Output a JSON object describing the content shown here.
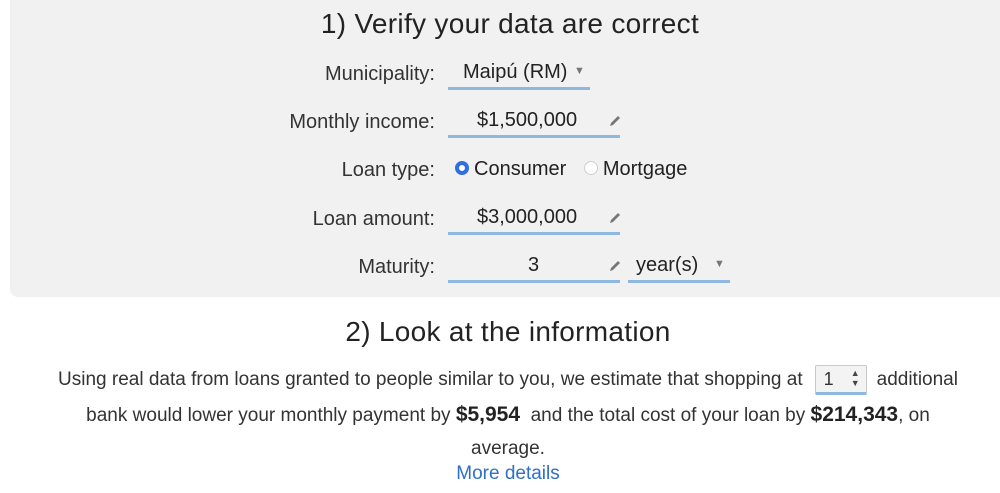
{
  "section1": {
    "title": "1) Verify your data are correct",
    "municipality_label": "Municipality:",
    "municipality_value": "Maipú (RM)",
    "income_label": "Monthly income:",
    "income_value": "$1,500,000",
    "loan_type_label": "Loan type:",
    "loan_type_options": [
      "Consumer",
      "Mortgage"
    ],
    "loan_type_selected": "Consumer",
    "amount_label": "Loan amount:",
    "amount_value": "$3,000,000",
    "maturity_label": "Maturity:",
    "maturity_value": "3",
    "maturity_unit": "year(s)"
  },
  "section2": {
    "title": "2) Look at the information",
    "text_before": "Using real data from loans granted to people similar to you, we estimate that shopping at",
    "banks_value": "1",
    "text_after_banks": "additional",
    "text_line2": "bank would lower your monthly payment by",
    "monthly_saving": "$5,954",
    "text_mid": "and the total cost of your loan by",
    "total_saving": "$214,343",
    "text_end": ", on",
    "text_line3": "average.",
    "more_link": "More details"
  },
  "colors": {
    "accent": "#2f6fe0",
    "underline": "#8fb8e0",
    "link": "#2e6fc8",
    "panel": "#f1f1f1"
  },
  "icons": [
    "caret-down-icon",
    "pencil-icon",
    "spin-arrows-icon"
  ]
}
